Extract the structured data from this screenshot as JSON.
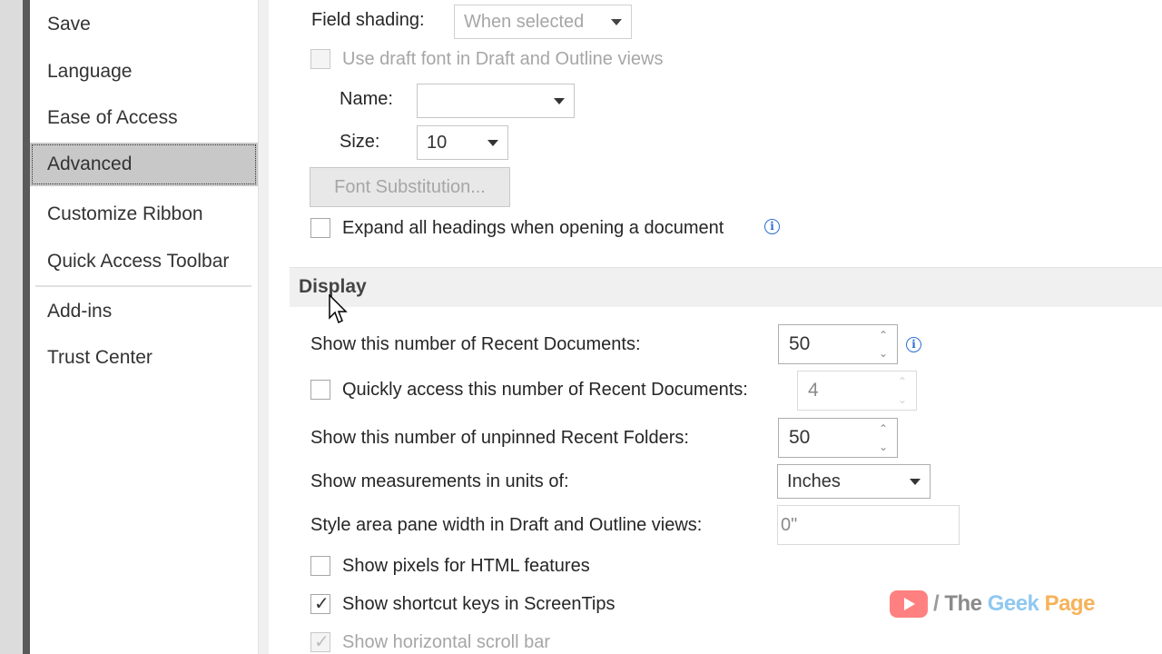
{
  "sidebar": {
    "items": [
      {
        "label": "Save"
      },
      {
        "label": "Language"
      },
      {
        "label": "Ease of Access"
      },
      {
        "label": "Advanced",
        "selected": true
      },
      {
        "label": "Customize Ribbon"
      },
      {
        "label": "Quick Access Toolbar"
      },
      {
        "label": "Add-ins"
      },
      {
        "label": "Trust Center"
      }
    ]
  },
  "options": {
    "field_shading": {
      "label": "Field shading:",
      "value": "When selected"
    },
    "draft_font": {
      "label": "Use draft font in Draft and Outline views",
      "checked": false
    },
    "name": {
      "label": "Name:",
      "value": ""
    },
    "size": {
      "label": "Size:",
      "value": "10"
    },
    "font_substitution": {
      "label": "Font Substitution..."
    },
    "expand_headings": {
      "label": "Expand all headings when opening a document",
      "checked": false
    }
  },
  "display": {
    "header": "Display",
    "recent_documents": {
      "label": "Show this number of Recent Documents:",
      "value": "50"
    },
    "quick_access": {
      "label": "Quickly access this number of Recent Documents:",
      "value": "4",
      "checked": false
    },
    "recent_folders": {
      "label": "Show this number of unpinned Recent Folders:",
      "value": "50"
    },
    "measurement_units": {
      "label": "Show measurements in units of:",
      "value": "Inches"
    },
    "style_area": {
      "label": "Style area pane width in Draft and Outline views:",
      "value": "0\""
    },
    "show_pixels": {
      "label": "Show pixels for HTML features",
      "checked": false
    },
    "shortcut_keys": {
      "label": "Show shortcut keys in ScreenTips",
      "checked": true
    },
    "horizontal_scroll": {
      "label": "Show horizontal scroll bar",
      "checked": true
    }
  },
  "watermark": {
    "slash": "/",
    "the": "The",
    "geek": "Geek",
    "page": "Page"
  },
  "colors": {
    "accent_info": "#2a6fd6",
    "selected_nav": "#c8c8c8"
  }
}
